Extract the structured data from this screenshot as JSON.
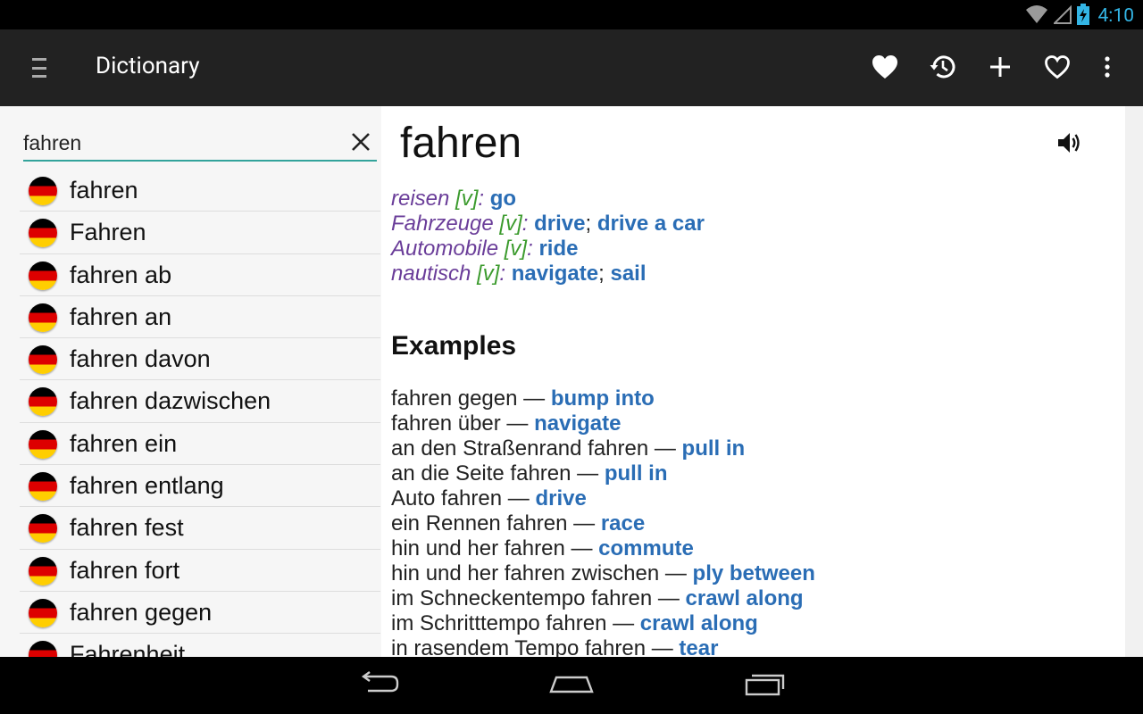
{
  "status_bar": {
    "time": "4:10",
    "wifi_icon": "wifi-icon",
    "signal_icon": "signal-icon",
    "battery_icon": "battery-charging-icon"
  },
  "action_bar": {
    "title": "Dictionary",
    "actions": [
      {
        "name": "favorites-filled",
        "icon": "heart-filled-icon"
      },
      {
        "name": "history",
        "icon": "history-icon"
      },
      {
        "name": "add",
        "icon": "plus-icon"
      },
      {
        "name": "favorite",
        "icon": "heart-outline-icon"
      },
      {
        "name": "overflow-menu",
        "icon": "more-vert-icon"
      }
    ]
  },
  "search": {
    "value": "fahren",
    "placeholder": ""
  },
  "results": [
    "fahren",
    "Fahren",
    "fahren ab",
    "fahren an",
    "fahren davon",
    "fahren dazwischen",
    "fahren ein",
    "fahren entlang",
    "fahren fest",
    "fahren fort",
    "fahren gegen",
    "Fahrenheit"
  ],
  "entry": {
    "headword": "fahren",
    "definitions": [
      {
        "domain": "reisen",
        "pos": "[v]",
        "translations": [
          "go"
        ]
      },
      {
        "domain": "Fahrzeuge",
        "pos": "[v]",
        "translations": [
          "drive",
          "drive a car"
        ]
      },
      {
        "domain": "Automobile",
        "pos": "[v]",
        "translations": [
          "ride"
        ]
      },
      {
        "domain": "nautisch",
        "pos": "[v]",
        "translations": [
          "navigate",
          "sail"
        ]
      }
    ],
    "examples_heading": "Examples",
    "examples": [
      {
        "phrase": "fahren gegen",
        "translation": "bump into"
      },
      {
        "phrase": "fahren über",
        "translation": "navigate"
      },
      {
        "phrase": "an den Straßenrand fahren",
        "translation": "pull in"
      },
      {
        "phrase": "an die Seite fahren",
        "translation": "pull in"
      },
      {
        "phrase": "Auto fahren",
        "translation": "drive"
      },
      {
        "phrase": "ein Rennen fahren",
        "translation": "race"
      },
      {
        "phrase": "hin und her fahren",
        "translation": "commute"
      },
      {
        "phrase": "hin und her fahren zwischen",
        "translation": "ply between"
      },
      {
        "phrase": "im Schneckentempo fahren",
        "translation": "crawl along"
      },
      {
        "phrase": "im Schritttempo fahren",
        "translation": "crawl along"
      },
      {
        "phrase": "in rasendem Tempo fahren",
        "translation": "tear"
      }
    ]
  },
  "colors": {
    "accent": "#33b5e5",
    "search_underline": "#33a39b",
    "translation": "#2a6db5",
    "domain": "#6a3d99",
    "pos": "#3c9b2e"
  }
}
